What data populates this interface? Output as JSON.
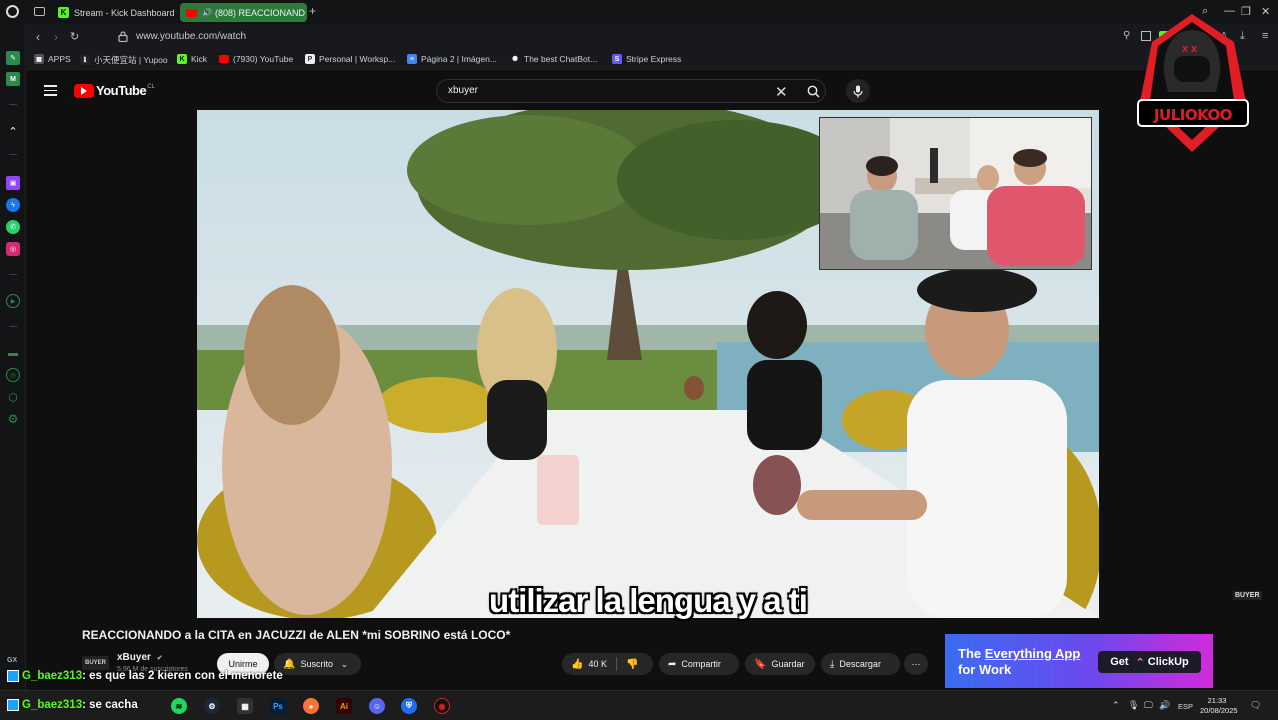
{
  "browser": {
    "tabs": [
      {
        "label": "Stream - Kick Dashboard",
        "active": false
      },
      {
        "label": "(808) REACCIONAND",
        "active": true
      }
    ],
    "new_tab": "+",
    "url": "www.youtube.com/watch",
    "bookmarks": [
      {
        "label": "APPS"
      },
      {
        "label": "小天便宜站 | Yupoo"
      },
      {
        "label": "Kick"
      },
      {
        "label": "(7930) YouTube"
      },
      {
        "label": "Personal | Worksp..."
      },
      {
        "label": "Página 2 | Imágen..."
      },
      {
        "label": "The best ChatBot..."
      },
      {
        "label": "Stripe Express"
      }
    ]
  },
  "youtube": {
    "logo_text": "YouTube",
    "country": "CL",
    "search_value": "xbuyer",
    "video": {
      "caption": "utilizar la lengua y a ti",
      "watermark": "BUYER",
      "title": "REACCIONANDO a la CITA en JACUZZI de ALEN *mi SOBRINO está LOCO*"
    },
    "channel": {
      "avatar_text": "BUYER",
      "name": "xBuyer",
      "subs": "5,96 M de suscriptores"
    },
    "actions": {
      "join": "Unirme",
      "subscribed": "Suscrito",
      "likes": "40 K",
      "share": "Compartir",
      "save": "Guardar",
      "download": "Descargar"
    }
  },
  "ad": {
    "line1_prefix": "The ",
    "line1_underlined": "Everything App",
    "line2": "for Work",
    "cta_get": "Get",
    "cta_brand": "ClickUp"
  },
  "overlay": {
    "logo_text": "JULIOKOO",
    "chat": [
      {
        "user": "G_baez313",
        "message": " : es que las 2 kieren con el menorete"
      },
      {
        "user": "G_baez313",
        "message": " : se cacha"
      }
    ]
  },
  "taskbar": {
    "lang": "ESP",
    "time": "21:33",
    "date": "20/08/2025"
  },
  "sidebar": {
    "gx_label": "GX"
  }
}
